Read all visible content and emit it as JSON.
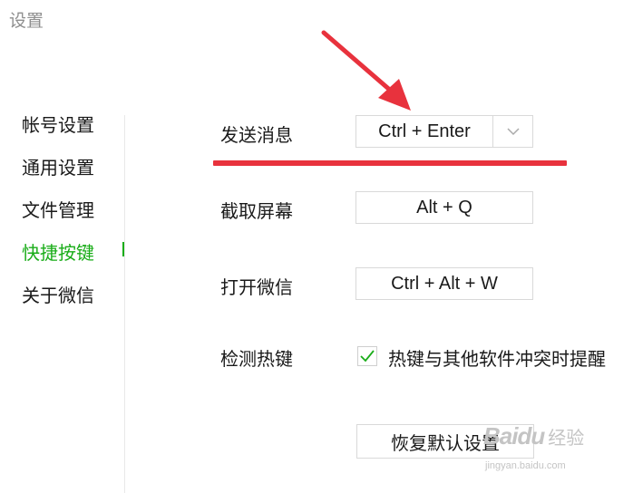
{
  "window": {
    "title": "设置"
  },
  "sidebar": {
    "items": [
      {
        "label": "帐号设置"
      },
      {
        "label": "通用设置"
      },
      {
        "label": "文件管理"
      },
      {
        "label": "快捷按键"
      },
      {
        "label": "关于微信"
      }
    ],
    "active_index": 3,
    "active_color": "#1aad19"
  },
  "hotkeys": {
    "send_message": {
      "label": "发送消息",
      "value": "Ctrl + Enter"
    },
    "screenshot": {
      "label": "截取屏幕",
      "value": "Alt + Q"
    },
    "open_wechat": {
      "label": "打开微信",
      "value": "Ctrl + Alt + W"
    },
    "detect": {
      "label": "检测热键",
      "checkbox_label": "热键与其他软件冲突时提醒",
      "checked": true
    }
  },
  "restore_button": {
    "label": "恢复默认设置"
  },
  "annotation": {
    "color": "#e8323d"
  },
  "watermark": {
    "logo": "Baidu",
    "text": "经验",
    "sub": "jingyan.baidu.com"
  }
}
